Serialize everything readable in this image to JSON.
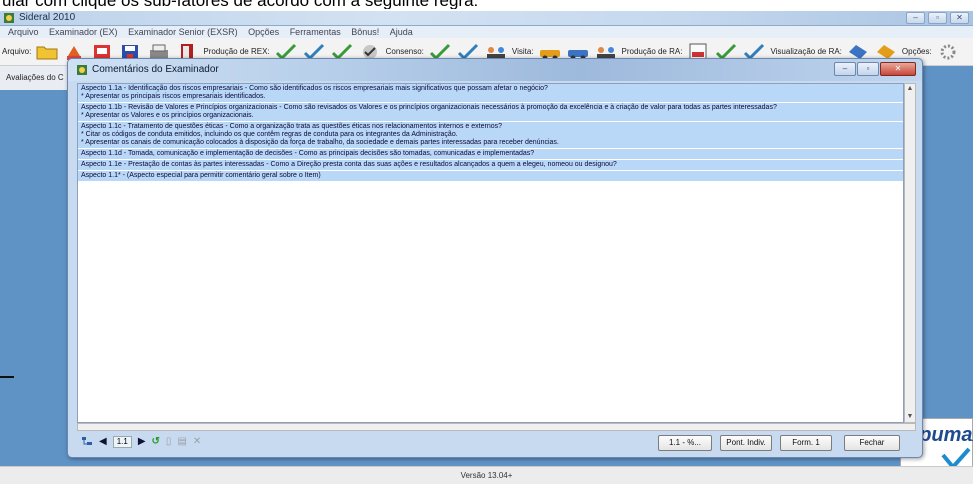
{
  "background_text": "ular com clique os sub-fatores de acordo com a seguinte regra:",
  "window": {
    "title": "Sideral 2010",
    "controls": [
      "–",
      "▫",
      "✕"
    ]
  },
  "menu": [
    "Arquivo",
    "Examinador (EX)",
    "Examinador Senior (EXSR)",
    "Opções",
    "Ferramentas",
    "Bônus!",
    "Ajuda"
  ],
  "toolbar": {
    "arquivo_label": "Arquivo:",
    "producao_rex_label": "Produção de REX:",
    "consenso_label": "Consenso:",
    "visita_label": "Visita:",
    "producao_ra_label": "Produção de RA:",
    "visualizacao_ra_label": "Visualização de RA:",
    "opcoes_label": "Opções:"
  },
  "left_panel_label": "Avaliações do C",
  "dialog": {
    "title": "Comentários do Examinador",
    "aspects": [
      {
        "lines": [
          "Aspecto 1.1a - Identificação dos riscos empresariais - Como são identificados os riscos empresariais mais significativos que possam afetar o negócio?",
          "* Apresentar os principais riscos empresariais identificados."
        ]
      },
      {
        "lines": [
          "Aspecto 1.1b - Revisão de Valores e Princípios organizacionais - Como são revisados os Valores e os princípios organizacionais necessários à promoção da excelência e à criação de valor para todas as partes interessadas?",
          "* Apresentar os Valores e os princípios organizacionais."
        ]
      },
      {
        "lines": [
          "Aspecto 1.1c - Tratamento de questões éticas  - Como a organização trata as questões éticas nos relacionamentos internos e externos?",
          "* Citar os códigos de conduta emitidos, incluindo os que contêm regras de conduta para os integrantes da Administração.",
          "* Apresentar os canais de comunicação colocados à disposição da força de trabalho, da sociedade e demais partes interessadas para receber denúncias."
        ]
      },
      {
        "lines": [
          "Aspecto 1.1d - Tomada, comunicação e implementação de decisões  - Como as principais decisões são tomadas, comunicadas e implementadas?"
        ]
      },
      {
        "lines": [
          "Aspecto 1.1e - Prestação de contas às partes interessadas - Como a Direção presta conta das suas ações e resultados alcançados a quem a elegeu, nomeou ou designou?"
        ]
      },
      {
        "lines": [
          "Aspecto 1.1* - (Aspecto especial para permitir comentário geral sobre o Item)"
        ]
      }
    ],
    "nav": {
      "page_value": "1.1"
    },
    "buttons": {
      "percent": "1.1 - %...",
      "pont_indiv": "Pont. Indiv.",
      "form1": "Form. 1",
      "fechar": "Fechar"
    }
  },
  "logo_text": "npumax",
  "version": "Versão 13.04+",
  "colors": {
    "desktop_bg": "#5f93c6",
    "aspect_bg": "#b9d7f7",
    "dialog_frame": "#c8daef"
  }
}
